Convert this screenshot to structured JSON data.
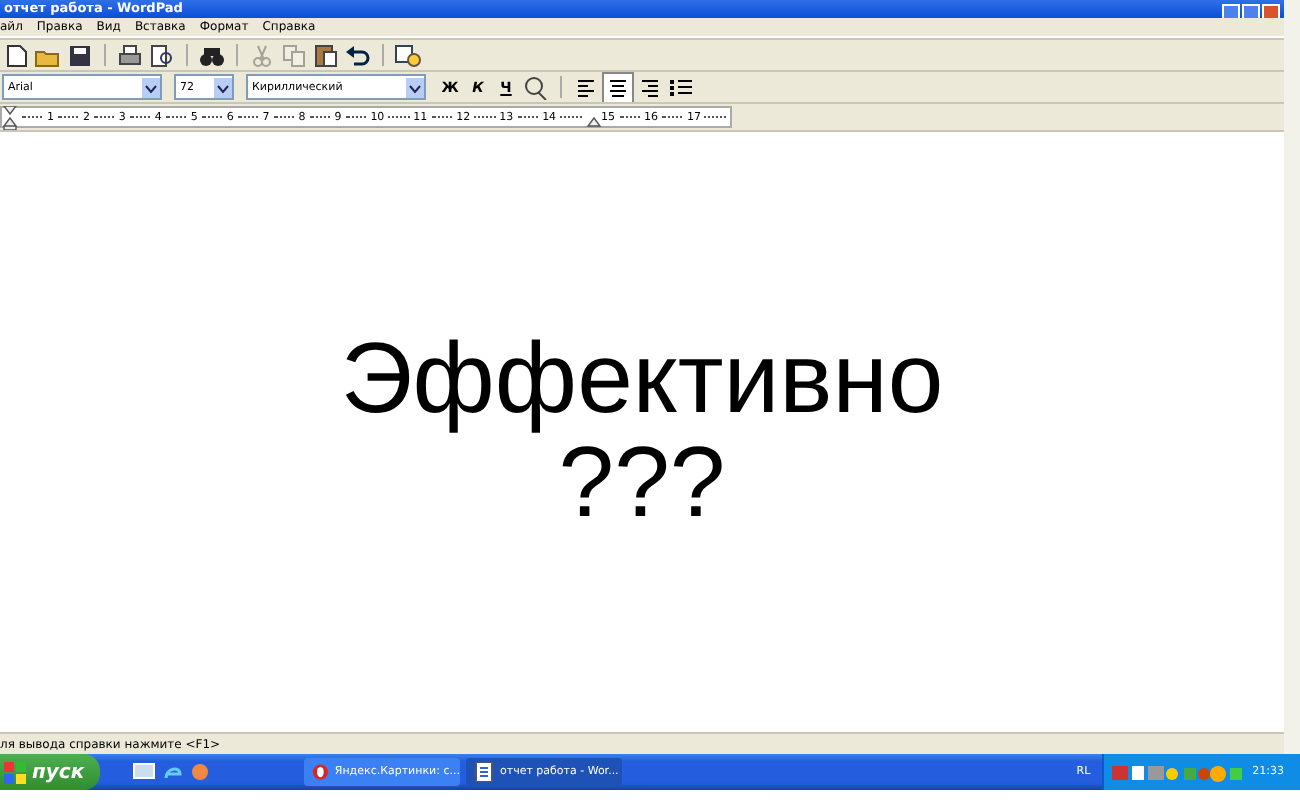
{
  "window": {
    "title": "отчет работа - WordPad"
  },
  "menu": [
    "айл",
    "Правка",
    "Вид",
    "Вставка",
    "Формат",
    "Справка"
  ],
  "toolbar": [
    {
      "kind": "new",
      "disabled": false
    },
    {
      "kind": "open",
      "disabled": false
    },
    {
      "kind": "save",
      "disabled": false
    },
    {
      "kind": "sep"
    },
    {
      "kind": "print",
      "disabled": false
    },
    {
      "kind": "preview",
      "disabled": false
    },
    {
      "kind": "sep"
    },
    {
      "kind": "find",
      "disabled": false
    },
    {
      "kind": "sep"
    },
    {
      "kind": "cut",
      "disabled": true
    },
    {
      "kind": "copy",
      "disabled": true
    },
    {
      "kind": "paste",
      "disabled": false
    },
    {
      "kind": "undo",
      "disabled": false
    },
    {
      "kind": "sep"
    },
    {
      "kind": "datetime",
      "disabled": false
    }
  ],
  "format_bar": {
    "font": "Arial",
    "size": "72",
    "script": "Кириллический",
    "styles": [
      {
        "label": "Ж",
        "kind": "bold",
        "selected": false
      },
      {
        "label": "К",
        "kind": "italic",
        "selected": false
      },
      {
        "label": "Ч",
        "kind": "underline",
        "selected": false
      }
    ],
    "alignment": [
      {
        "kind": "left",
        "selected": false
      },
      {
        "kind": "center",
        "selected": true
      },
      {
        "kind": "right",
        "selected": false
      }
    ]
  },
  "ruler": [
    "1",
    "2",
    "3",
    "4",
    "5",
    "6",
    "7",
    "8",
    "9",
    "10",
    "11",
    "12",
    "13",
    "14",
    "15",
    "16",
    "17"
  ],
  "document": {
    "lines": [
      "Эффективно",
      "???"
    ]
  },
  "status_bar": "ля вывода справки нажмите <F1>",
  "taskbar": {
    "start": "пуск",
    "tasks": [
      {
        "label": "Яндекс.Картинки: с...",
        "kind": "browser",
        "selected": false
      },
      {
        "label": "отчет работа - Wor...",
        "kind": "editor",
        "selected": true
      }
    ],
    "language": "RL",
    "clock": "21:33"
  }
}
